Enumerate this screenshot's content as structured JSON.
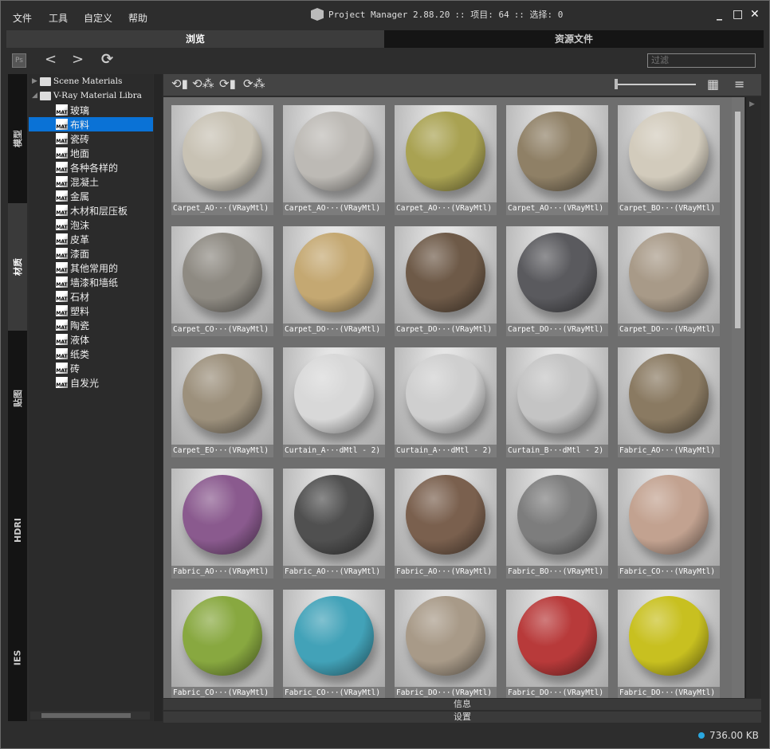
{
  "menu": [
    "文件",
    "工具",
    "自定义",
    "帮助"
  ],
  "title": {
    "app": "Project Manager 2.88.20",
    "items_label": ":: 项目: 64",
    "selection_label": ":: 选择: 0"
  },
  "tabs": {
    "browse": "浏览",
    "assets": "资源文件"
  },
  "toolbar": {
    "ps": "Ps",
    "back": "<",
    "forward": ">",
    "refresh": "⟳",
    "filter_placeholder": "过滤"
  },
  "side_tabs": [
    "模型",
    "材质",
    "贴图",
    "HDRI",
    "IES"
  ],
  "tree": {
    "roots": [
      "Scene Materials",
      "V-Ray Material Libra"
    ],
    "children": [
      "玻璃",
      "布料",
      "瓷砖",
      "地面",
      "各种各样的",
      "混凝土",
      "金属",
      "木材和层压板",
      "泡沫",
      "皮革",
      "漆面",
      "其他常用的",
      "墙漆和墙纸",
      "石材",
      "塑料",
      "陶瓷",
      "液体",
      "纸类",
      "砖",
      "自发光"
    ],
    "selected": "布料"
  },
  "zoom_slider": 0,
  "items": [
    {
      "label": "Carpet_AO···(VRayMtl)",
      "color": "#c8c2b4"
    },
    {
      "label": "Carpet_AO···(VRayMtl)",
      "color": "#bdbab5"
    },
    {
      "label": "Carpet_AO···(VRayMtl)",
      "color": "#a9a252"
    },
    {
      "label": "Carpet_AO···(VRayMtl)",
      "color": "#8f8066"
    },
    {
      "label": "Carpet_BO···(VRayMtl)",
      "color": "#d2cbbc"
    },
    {
      "label": "Carpet_CO···(VRayMtl)",
      "color": "#8e8a82"
    },
    {
      "label": "Carpet_DO···(VRayMtl)",
      "color": "#c4a872"
    },
    {
      "label": "Carpet_DO···(VRayMtl)",
      "color": "#6e5a48"
    },
    {
      "label": "Carpet_DO···(VRayMtl)",
      "color": "#5a5a5e"
    },
    {
      "label": "Carpet_DO···(VRayMtl)",
      "color": "#a89a88"
    },
    {
      "label": "Carpet_EO···(VRayMtl)",
      "color": "#9c907c"
    },
    {
      "label": "Curtain_A···dMtl - 2)",
      "color": "#d8d8d8"
    },
    {
      "label": "Curtain_A···dMtl - 2)",
      "color": "#cfcfcf"
    },
    {
      "label": "Curtain_B···dMtl - 2)",
      "color": "#c4c4c4"
    },
    {
      "label": "Fabric_AO···(VRayMtl)",
      "color": "#8a7a62"
    },
    {
      "label": "Fabric_AO···(VRayMtl)",
      "color": "#8a5a8e"
    },
    {
      "label": "Fabric_AO···(VRayMtl)",
      "color": "#505050"
    },
    {
      "label": "Fabric_AO···(VRayMtl)",
      "color": "#7a604e"
    },
    {
      "label": "Fabric_BO···(VRayMtl)",
      "color": "#7d7d7d"
    },
    {
      "label": "Fabric_CO···(VRayMtl)",
      "color": "#c2a290"
    },
    {
      "label": "Fabric_CO···(VRayMtl)",
      "color": "#88a840"
    },
    {
      "label": "Fabric_CO···(VRayMtl)",
      "color": "#42a2b8"
    },
    {
      "label": "Fabric_DO···(VRayMtl)",
      "color": "#a89a88"
    },
    {
      "label": "Fabric_DO···(VRayMtl)",
      "color": "#b83a3a"
    },
    {
      "label": "Fabric_DO···(VRayMtl)",
      "color": "#c8c020"
    }
  ],
  "panels": {
    "info": "信息",
    "settings": "设置"
  },
  "status": {
    "size": "736.00 KB",
    "dot_color": "#2aa8e0"
  }
}
